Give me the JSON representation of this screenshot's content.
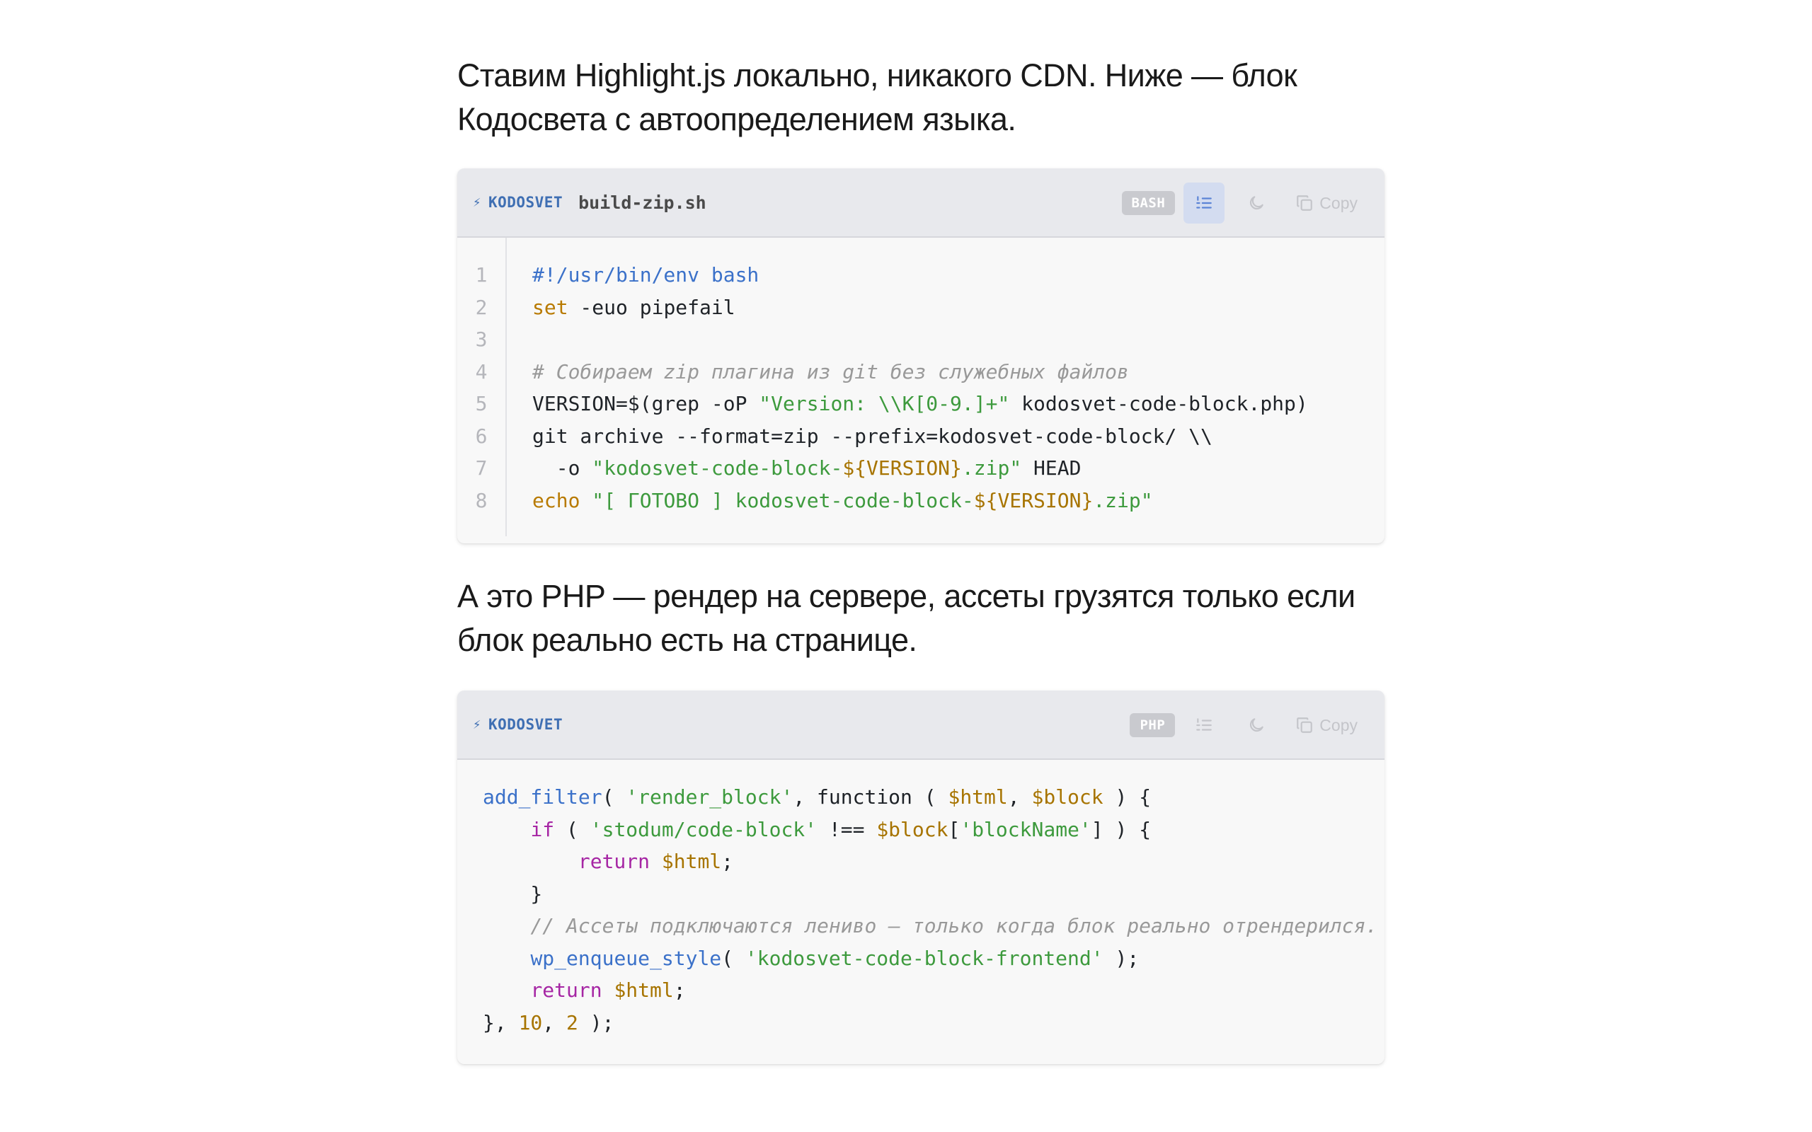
{
  "paragraphs": {
    "p1_line1": "Ставим Highlight.js локально, никакого CDN. Ниже — блок",
    "p1_line2": "Кодосвета с автоопределением языка.",
    "p2_line1": "А это PHP — рендер на сервере, ассеты грузятся только если",
    "p2_line2": "блок реально есть на странице."
  },
  "block1": {
    "brand": "KODOSVET",
    "filename": "build-zip.sh",
    "language": "BASH",
    "copy_label": "Copy",
    "line_numbers": [
      "1",
      "2",
      "3",
      "4",
      "5",
      "6",
      "7",
      "8"
    ],
    "lines": [
      [
        {
          "t": "#!/usr/bin/env bash",
          "c": "meta"
        }
      ],
      [
        {
          "t": "set",
          "c": "bi"
        },
        {
          "t": " -euo pipefail",
          "c": "pl"
        }
      ],
      [
        {
          "t": "",
          "c": "pl"
        }
      ],
      [
        {
          "t": "# Собираем zip плагина из git без служебных файлов",
          "c": "cm"
        }
      ],
      [
        {
          "t": "VERSION=$(grep -oP ",
          "c": "pl"
        },
        {
          "t": "\"Version: \\\\K[0-9.]+\"",
          "c": "str"
        },
        {
          "t": " kodosvet-code-block.php)",
          "c": "pl"
        }
      ],
      [
        {
          "t": "git archive --format=zip --prefix=kodosvet-code-block/ \\\\",
          "c": "pl"
        }
      ],
      [
        {
          "t": "  -o ",
          "c": "pl"
        },
        {
          "t": "\"kodosvet-code-block-",
          "c": "str"
        },
        {
          "t": "${VERSION}",
          "c": "var"
        },
        {
          "t": ".zip\"",
          "c": "str"
        },
        {
          "t": " HEAD",
          "c": "pl"
        }
      ],
      [
        {
          "t": "echo",
          "c": "bi"
        },
        {
          "t": " ",
          "c": "pl"
        },
        {
          "t": "\"[ ГОТОВО ] kodosvet-code-block-",
          "c": "str"
        },
        {
          "t": "${VERSION}",
          "c": "var"
        },
        {
          "t": ".zip\"",
          "c": "str"
        }
      ]
    ]
  },
  "block2": {
    "brand": "KODOSVET",
    "language": "PHP",
    "copy_label": "Copy",
    "lines": [
      [
        {
          "t": "add_filter",
          "c": "fn"
        },
        {
          "t": "( ",
          "c": "pl"
        },
        {
          "t": "'render_block'",
          "c": "str"
        },
        {
          "t": ", function ( ",
          "c": "pl"
        },
        {
          "t": "$html",
          "c": "var"
        },
        {
          "t": ", ",
          "c": "pl"
        },
        {
          "t": "$block",
          "c": "var"
        },
        {
          "t": " ) {",
          "c": "pl"
        }
      ],
      [
        {
          "t": "    ",
          "c": "pl"
        },
        {
          "t": "if",
          "c": "kw2"
        },
        {
          "t": " ( ",
          "c": "pl"
        },
        {
          "t": "'stodum/code-block'",
          "c": "str"
        },
        {
          "t": " !== ",
          "c": "pl"
        },
        {
          "t": "$block",
          "c": "var"
        },
        {
          "t": "[",
          "c": "pl"
        },
        {
          "t": "'blockName'",
          "c": "str"
        },
        {
          "t": "] ) {",
          "c": "pl"
        }
      ],
      [
        {
          "t": "        ",
          "c": "pl"
        },
        {
          "t": "return",
          "c": "kw2"
        },
        {
          "t": " ",
          "c": "pl"
        },
        {
          "t": "$html",
          "c": "var"
        },
        {
          "t": ";",
          "c": "pl"
        }
      ],
      [
        {
          "t": "    }",
          "c": "pl"
        }
      ],
      [
        {
          "t": "    ",
          "c": "pl"
        },
        {
          "t": "// Ассеты подключаются лениво — только когда блок реально отрендерился.",
          "c": "cm"
        }
      ],
      [
        {
          "t": "    ",
          "c": "pl"
        },
        {
          "t": "wp_enqueue_style",
          "c": "fn"
        },
        {
          "t": "( ",
          "c": "pl"
        },
        {
          "t": "'kodosvet-code-block-frontend'",
          "c": "str"
        },
        {
          "t": " );",
          "c": "pl"
        }
      ],
      [
        {
          "t": "    ",
          "c": "pl"
        },
        {
          "t": "return",
          "c": "kw2"
        },
        {
          "t": " ",
          "c": "pl"
        },
        {
          "t": "$html",
          "c": "var"
        },
        {
          "t": ";",
          "c": "pl"
        }
      ],
      [
        {
          "t": "}, ",
          "c": "pl"
        },
        {
          "t": "10",
          "c": "num"
        },
        {
          "t": ", ",
          "c": "pl"
        },
        {
          "t": "2",
          "c": "num"
        },
        {
          "t": " );",
          "c": "pl"
        }
      ]
    ]
  },
  "colors": {
    "brand": "#3f6fb3",
    "header_bg": "#e8e9ed",
    "code_bg": "#f8f8f8",
    "active_toggle": "#d3dcf0"
  },
  "icons": {
    "bolt": "lightning-icon",
    "line_numbers": "list-ordered-icon",
    "theme": "moon-icon",
    "copy": "copy-icon"
  }
}
